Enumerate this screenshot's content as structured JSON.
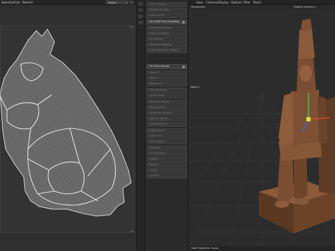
{
  "uv_editor": {
    "menu": [
      "Selection",
      "Fold",
      "Refresh"
    ],
    "dropdown": "Project",
    "corner_top": "1,1",
    "corner_bottom": "1,0"
  },
  "commands": [
    {
      "label": "Cut UV Seams",
      "active": false
    },
    {
      "label": "Relaxed UV Map",
      "active": false
    },
    {
      "label": "Optimize UV",
      "active": false
    },
    {
      "label": "Set UVW From Projection",
      "active": true
    },
    {
      "label": "UV Seams Editing",
      "active": false
    },
    {
      "label": "Stitch and Relax",
      "active": false
    },
    {
      "label": "UV Packing",
      "active": false
    },
    {
      "label": "Optimize Mapping",
      "active": false
    },
    {
      "label": "Edge Alignment Options",
      "active": false
    },
    {
      "label": "Fit UV to Canvas",
      "active": true
    },
    {
      "label": "Mirror U",
      "active": false
    },
    {
      "label": "Mirror V",
      "active": false
    },
    {
      "label": "Rotate 90°",
      "active": false
    },
    {
      "label": "Flip Horizontal",
      "active": false
    },
    {
      "label": "UV Stitching",
      "active": false
    },
    {
      "label": "Relax UV Islands",
      "active": false
    },
    {
      "label": "Align Vertical",
      "active": false
    },
    {
      "label": "Straighten Islands",
      "active": false
    },
    {
      "label": "Weld UV Points",
      "active": false
    },
    {
      "label": "Disconnect UV",
      "active": false
    },
    {
      "label": "Edge Seams",
      "active": false
    },
    {
      "label": "Stitch UVs",
      "active": false
    },
    {
      "label": "Pack Islands",
      "active": false
    },
    {
      "label": "Relax UV",
      "active": false
    },
    {
      "label": "UV Transform",
      "active": false
    },
    {
      "label": "Project",
      "active": false
    },
    {
      "label": "Terrace",
      "active": false
    },
    {
      "label": "Layout",
      "active": false
    },
    {
      "label": "UV Sets",
      "active": false
    }
  ],
  "viewport": {
    "menu": [
      "View",
      "Cameras",
      "Display",
      "Options",
      "Filter",
      "Panel"
    ],
    "perspective": "Perspective",
    "camera": "Default Camera ⊙",
    "move_label": "Move ✛",
    "status": "New Transform: Scene"
  },
  "colors": {
    "uv_wire": "#bdbdbd",
    "statue": "#8a5a3a",
    "axis_x": "#d94a3a",
    "axis_y": "#4ac24a",
    "axis_z": "#3a6ae0"
  }
}
